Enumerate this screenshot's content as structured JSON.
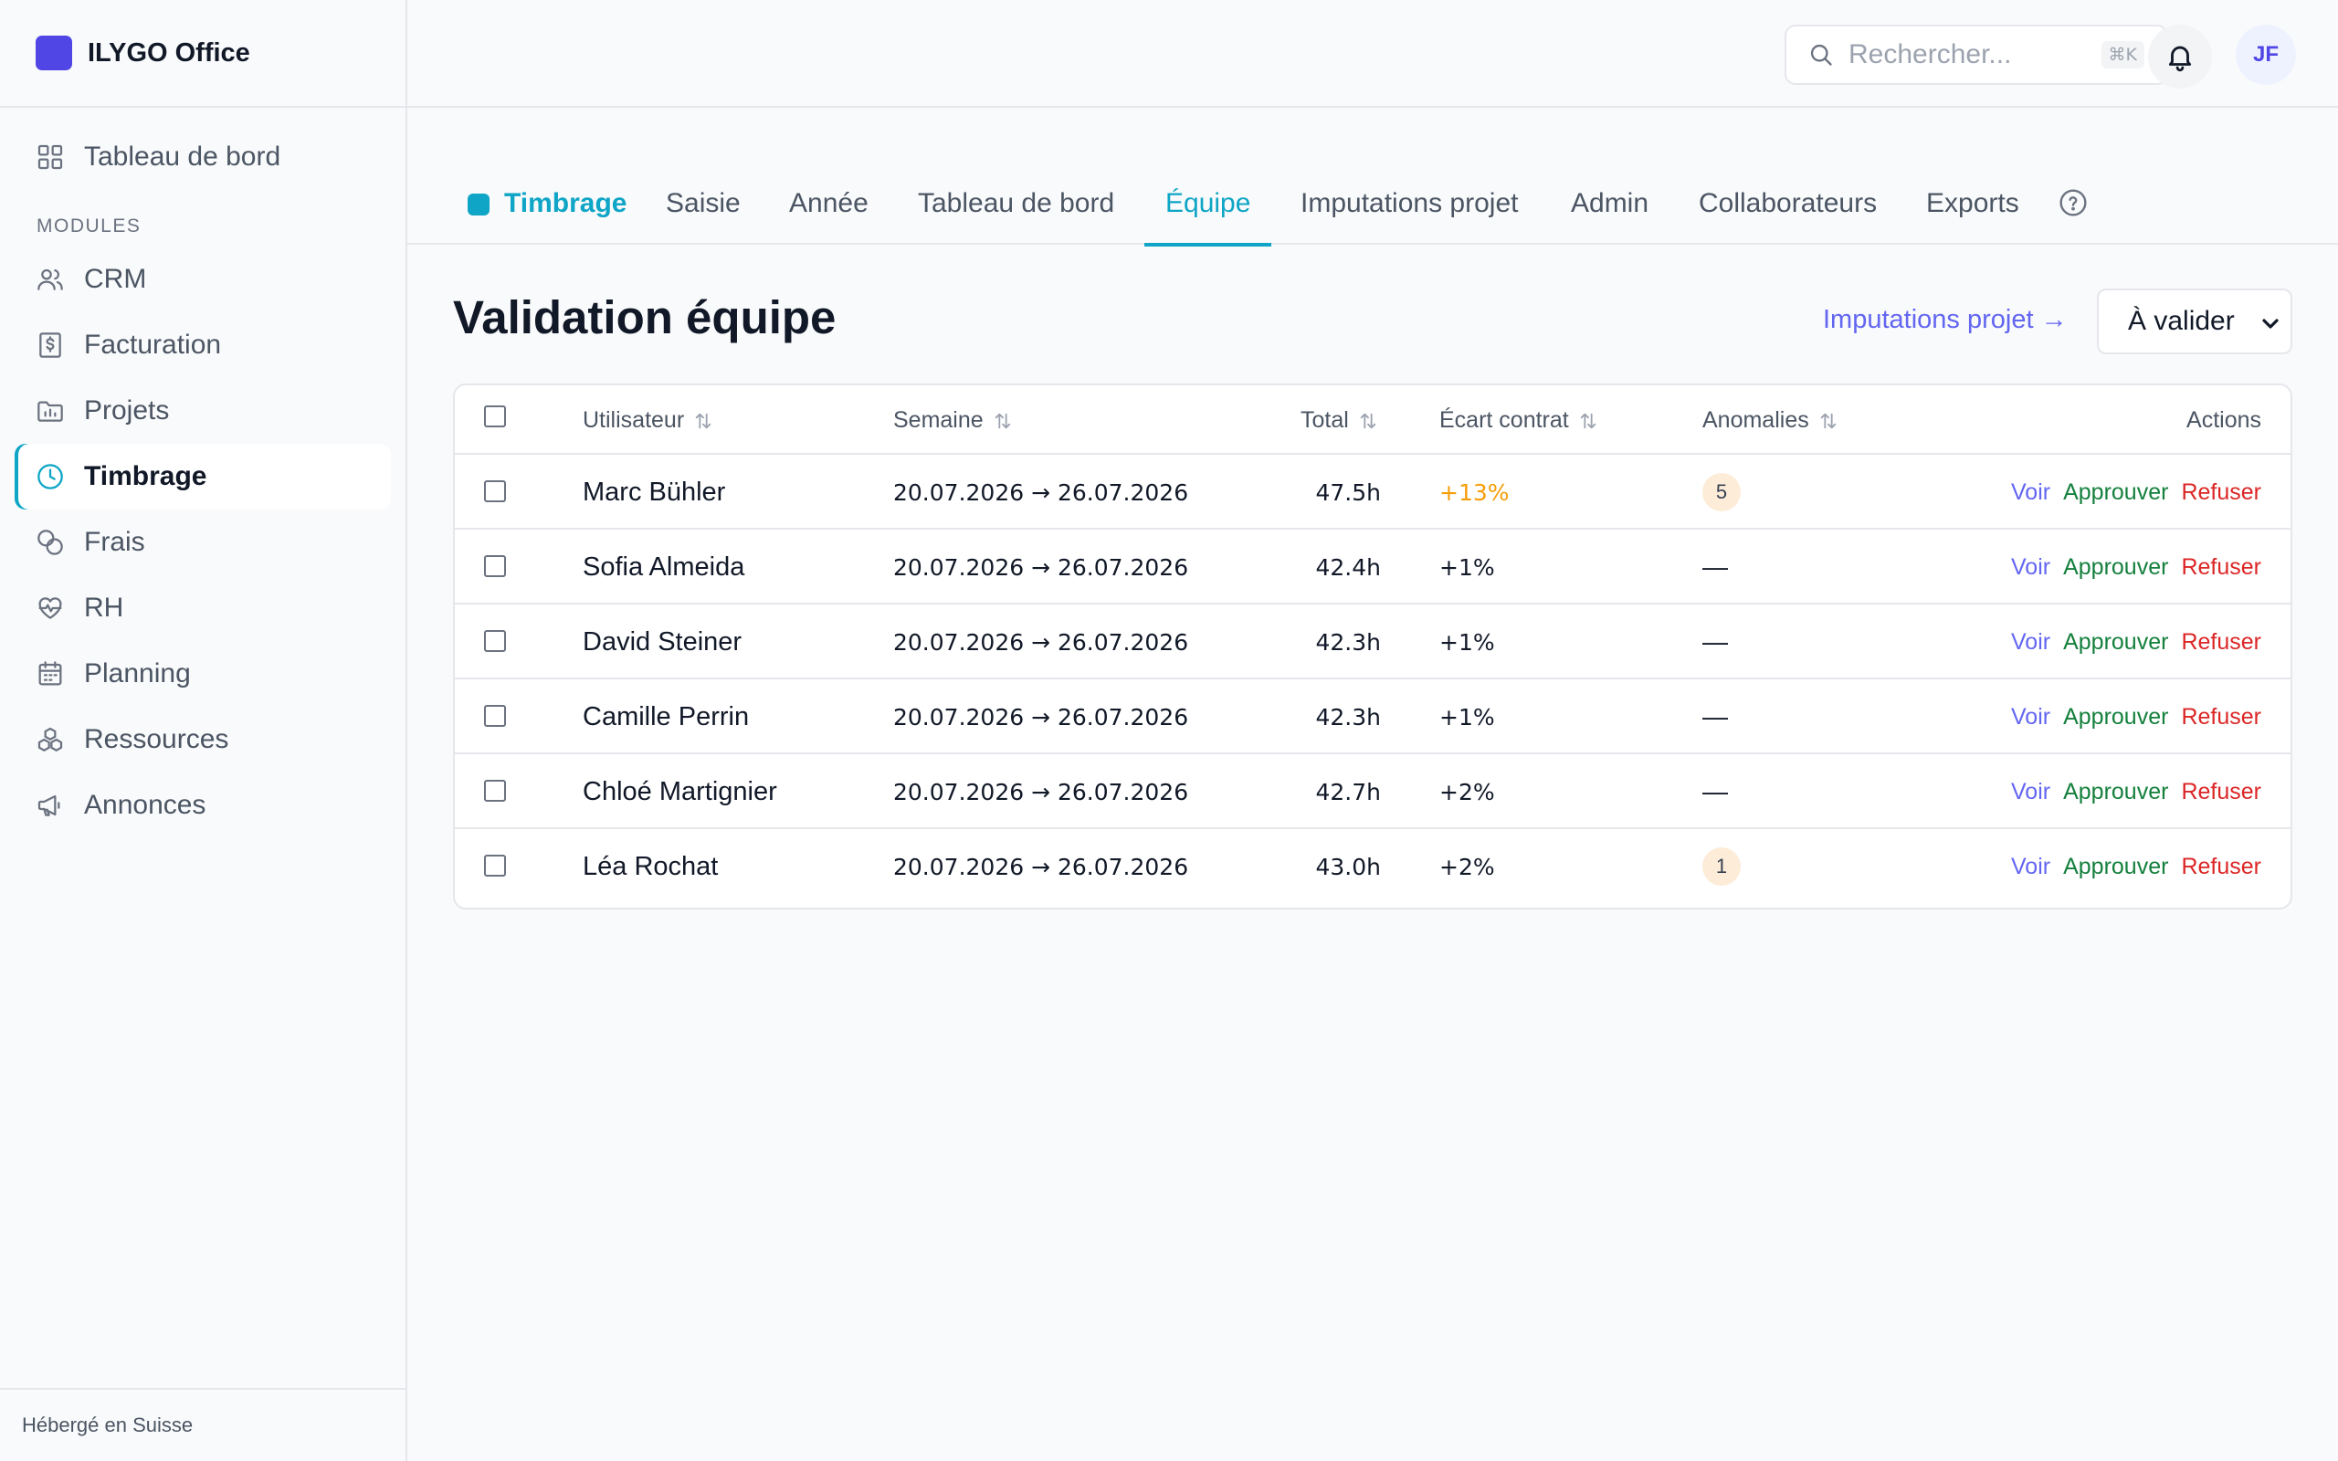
{
  "brand": {
    "name": "ILYGO Office",
    "color": "#4f46e5"
  },
  "sidebar": {
    "dashboard_label": "Tableau de bord",
    "modules_heading": "MODULES",
    "items": [
      {
        "label": "CRM",
        "icon": "users-icon"
      },
      {
        "label": "Facturation",
        "icon": "invoice-icon"
      },
      {
        "label": "Projets",
        "icon": "folder-icon"
      },
      {
        "label": "Timbrage",
        "icon": "clock-icon",
        "active": true
      },
      {
        "label": "Frais",
        "icon": "coins-icon"
      },
      {
        "label": "RH",
        "icon": "heart-pulse-icon"
      },
      {
        "label": "Planning",
        "icon": "calendar-icon"
      },
      {
        "label": "Ressources",
        "icon": "boxes-icon"
      },
      {
        "label": "Annonces",
        "icon": "megaphone-icon"
      }
    ],
    "footer": "Hébergé en Suisse"
  },
  "topbar": {
    "search_placeholder": "Rechercher...",
    "search_shortcut": "⌘K",
    "avatar_initials": "JF"
  },
  "tabs": {
    "module": "Timbrage",
    "items": [
      "Saisie",
      "Année",
      "Tableau de bord",
      "Équipe",
      "Imputations projet",
      "Admin",
      "Collaborateurs",
      "Exports"
    ],
    "active": "Équipe",
    "accent": "#0ea5c6"
  },
  "page": {
    "title": "Validation équipe",
    "projects_link": "Imputations projet →",
    "filter_value": "À valider"
  },
  "table": {
    "columns": {
      "user": "Utilisateur",
      "week": "Semaine",
      "total": "Total",
      "ecart": "Écart contrat",
      "anomalies": "Anomalies",
      "actions": "Actions"
    },
    "action_labels": {
      "view": "Voir",
      "approve": "Approuver",
      "reject": "Refuser"
    },
    "rows": [
      {
        "name": "Marc Bühler",
        "week": "20.07.2026 → 26.07.2026",
        "total": "47.5h",
        "ecart": "+13%",
        "ecart_warn": true,
        "anomalies": "5"
      },
      {
        "name": "Sofia Almeida",
        "week": "20.07.2026 → 26.07.2026",
        "total": "42.4h",
        "ecart": "+1%",
        "anomalies": "—"
      },
      {
        "name": "David Steiner",
        "week": "20.07.2026 → 26.07.2026",
        "total": "42.3h",
        "ecart": "+1%",
        "anomalies": "—"
      },
      {
        "name": "Camille Perrin",
        "week": "20.07.2026 → 26.07.2026",
        "total": "42.3h",
        "ecart": "+1%",
        "anomalies": "—"
      },
      {
        "name": "Chloé Martignier",
        "week": "20.07.2026 → 26.07.2026",
        "total": "42.7h",
        "ecart": "+2%",
        "anomalies": "—"
      },
      {
        "name": "Léa Rochat",
        "week": "20.07.2026 → 26.07.2026",
        "total": "43.0h",
        "ecart": "+2%",
        "anomalies": "1"
      }
    ]
  }
}
